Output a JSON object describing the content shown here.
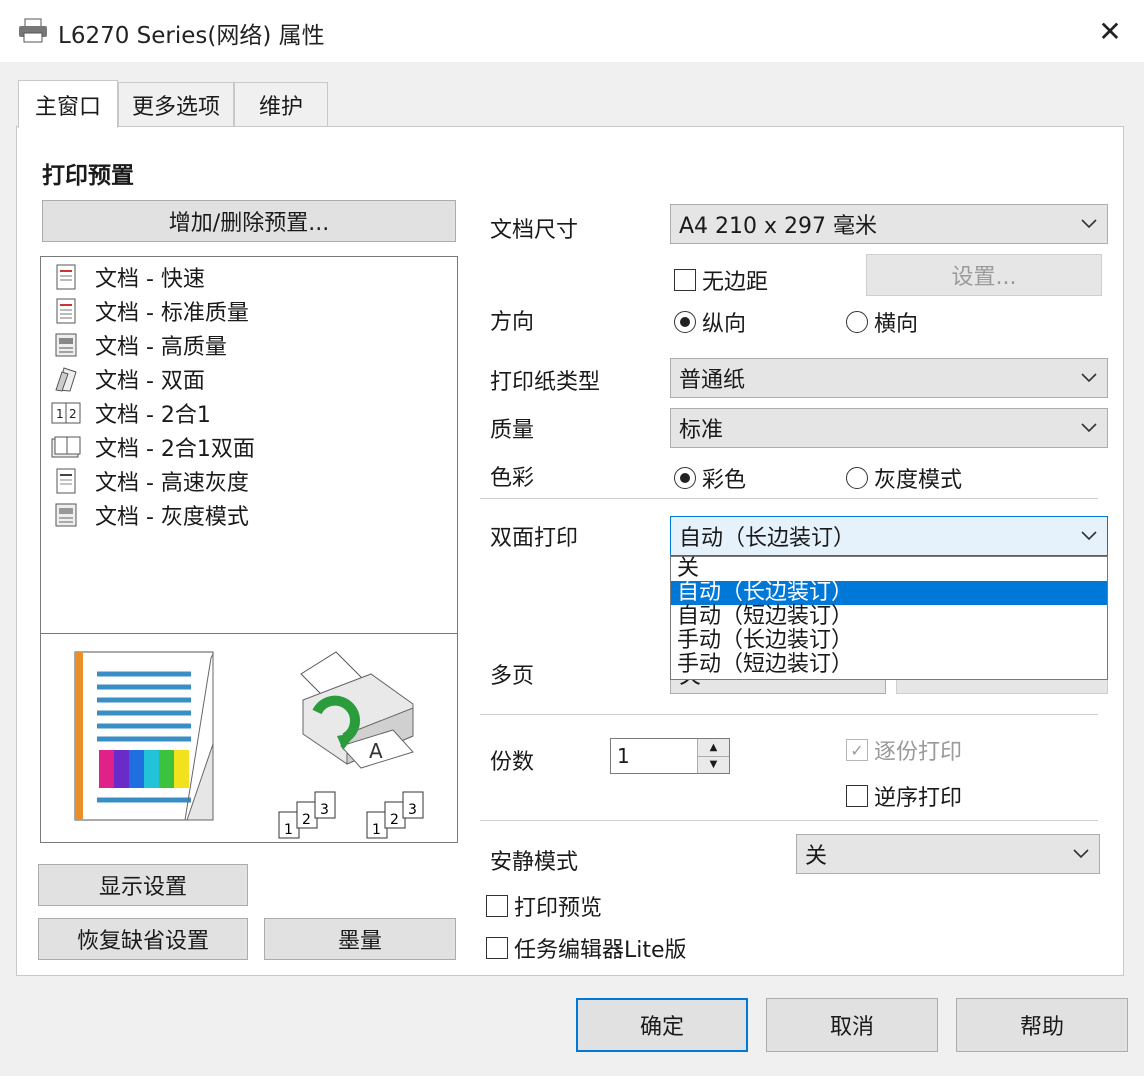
{
  "window": {
    "title": "L6270 Series(网络) 属性"
  },
  "tabs": [
    {
      "label": "主窗口",
      "active": true
    },
    {
      "label": "更多选项",
      "active": false
    },
    {
      "label": "维护",
      "active": false
    }
  ],
  "presets": {
    "title": "打印预置",
    "add_delete_label": "增加/删除预置...",
    "items": [
      {
        "label": "文档 - 快速",
        "icon": "document-fast-icon"
      },
      {
        "label": "文档 - 标准质量",
        "icon": "document-standard-icon"
      },
      {
        "label": "文档 - 高质量",
        "icon": "document-high-quality-icon"
      },
      {
        "label": "文档 - 双面",
        "icon": "document-duplex-icon"
      },
      {
        "label": "文档 - 2合1",
        "icon": "two-up-icon"
      },
      {
        "label": "文档 - 2合1双面",
        "icon": "two-up-duplex-icon"
      },
      {
        "label": "文档 - 高速灰度",
        "icon": "document-grayscale-fast-icon"
      },
      {
        "label": "文档 - 灰度模式",
        "icon": "document-grayscale-icon"
      }
    ]
  },
  "left_buttons": {
    "show_settings": "显示设置",
    "restore_defaults": "恢复缺省设置",
    "ink_levels": "墨量"
  },
  "settings": {
    "doc_size": {
      "label": "文档尺寸",
      "value": "A4 210 x 297 毫米"
    },
    "borderless": {
      "label": "无边距",
      "checked": false
    },
    "settings_button": "设置...",
    "orientation": {
      "label": "方向",
      "portrait": "纵向",
      "landscape": "横向",
      "selected": "portrait"
    },
    "paper_type": {
      "label": "打印纸类型",
      "value": "普通纸"
    },
    "quality": {
      "label": "质量",
      "value": "标准"
    },
    "color": {
      "label": "色彩",
      "color_option": "彩色",
      "grayscale_option": "灰度模式",
      "selected": "color"
    },
    "duplex": {
      "label": "双面打印",
      "value": "自动（长边装订）",
      "options": [
        "关",
        "自动（长边装订）",
        "自动（短边装订）",
        "手动（长边装订）",
        "手动（短边装订）"
      ],
      "selected_index": 1
    },
    "multipage": {
      "label": "多页",
      "value": "关"
    },
    "copies": {
      "label": "份数",
      "value": "1"
    },
    "collate": {
      "label": "逐份打印",
      "checked": true,
      "enabled": false
    },
    "reverse_order": {
      "label": "逆序打印",
      "checked": false
    },
    "quiet_mode": {
      "label": "安静模式",
      "value": "关"
    },
    "print_preview": {
      "label": "打印预览",
      "checked": false
    },
    "job_arranger": {
      "label": "任务编辑器Lite版",
      "checked": false
    }
  },
  "footer": {
    "ok": "确定",
    "cancel": "取消",
    "help": "帮助"
  },
  "colors": {
    "accent": "#0078d7",
    "window_bg": "#f0f0f0",
    "panel_bg": "#ffffff",
    "button_bg": "#e1e1e1"
  }
}
